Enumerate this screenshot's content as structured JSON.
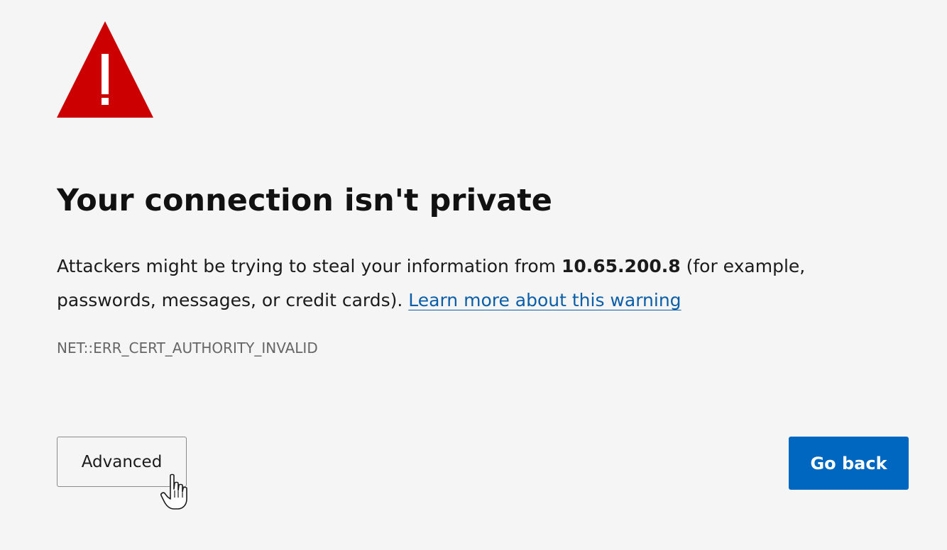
{
  "colors": {
    "background": "#f5f5f5",
    "warning_red": "#cc0000",
    "link_blue": "#0b5ea8",
    "primary_button": "#0067c0",
    "error_code_gray": "#666666"
  },
  "icons": {
    "warning": "warning-triangle-icon",
    "cursor": "hand-pointer-cursor-icon"
  },
  "title": "Your connection isn't private",
  "description": {
    "before_host": "Attackers might be trying to steal your information from ",
    "host": "10.65.200.8",
    "after_host": " (for example, passwords, messages, or credit cards). ",
    "learn_more_link": "Learn more about this warning"
  },
  "error_code": "NET::ERR_CERT_AUTHORITY_INVALID",
  "buttons": {
    "advanced_label": "Advanced",
    "go_back_label": "Go back"
  }
}
